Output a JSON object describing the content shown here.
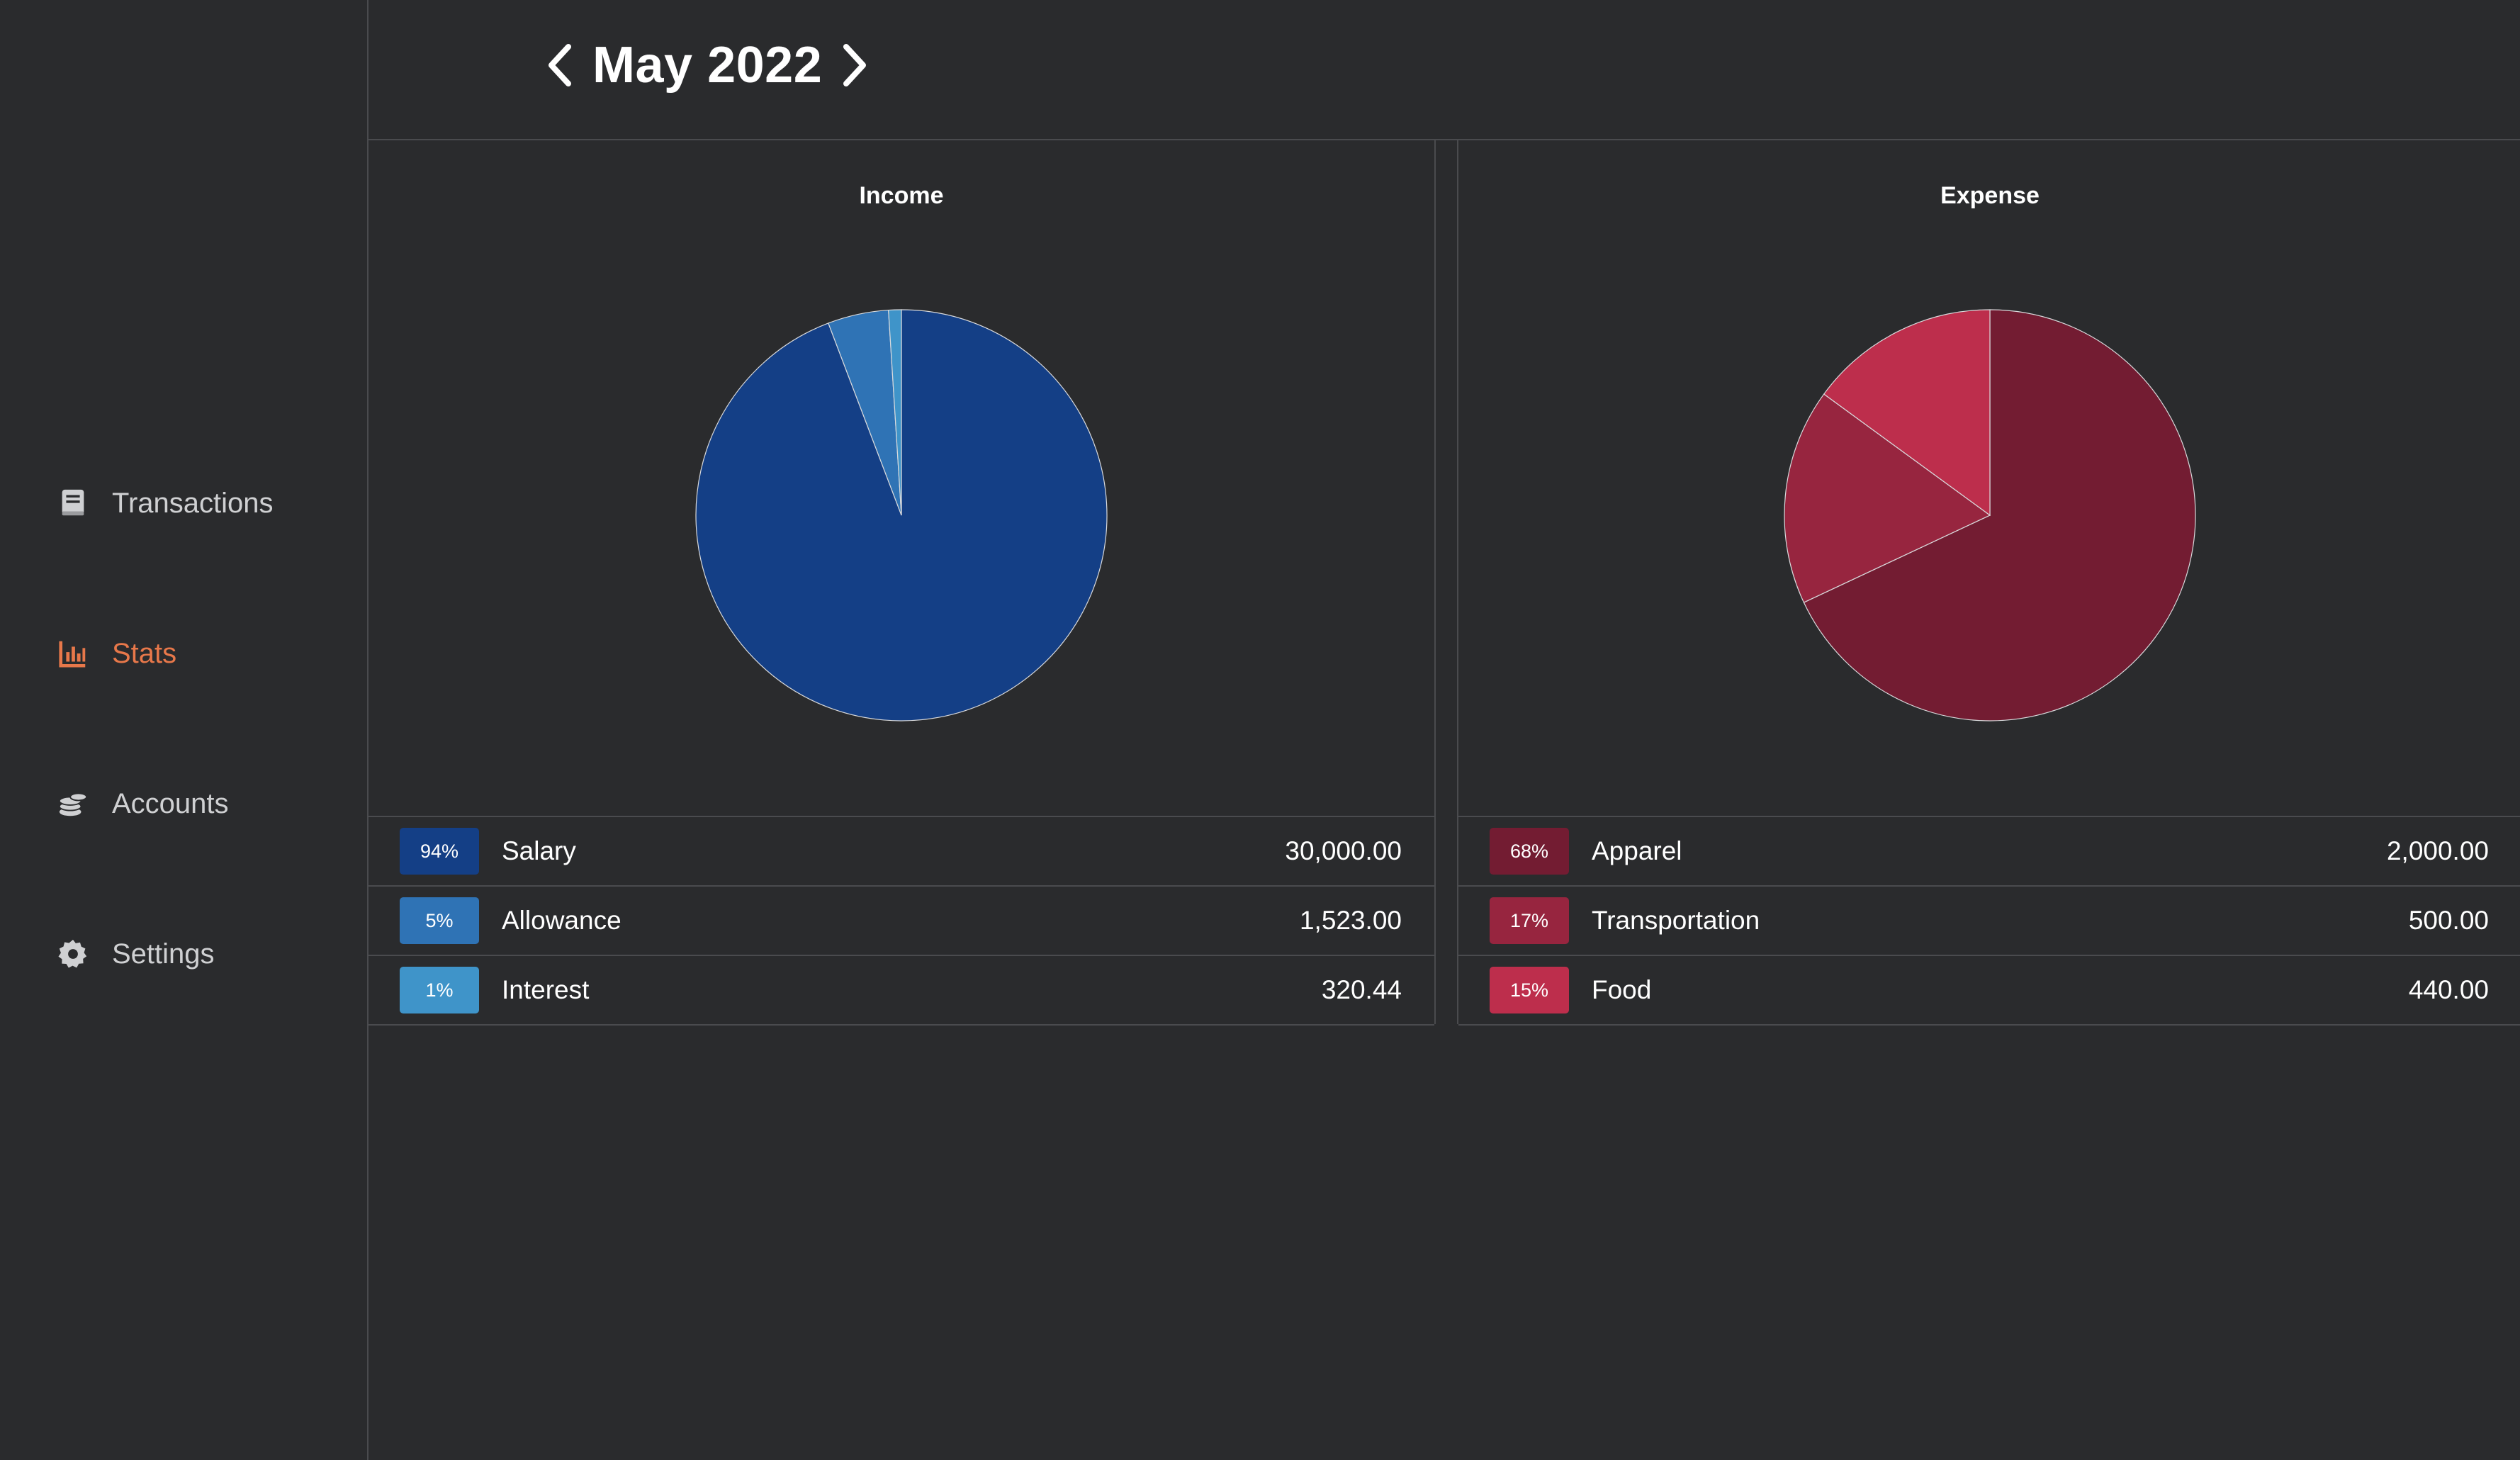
{
  "sidebar": {
    "items": [
      {
        "label": "Transactions",
        "icon": "receipt-icon",
        "active": false
      },
      {
        "label": "Stats",
        "icon": "bar-chart-icon",
        "active": true
      },
      {
        "label": "Accounts",
        "icon": "coins-icon",
        "active": false
      },
      {
        "label": "Settings",
        "icon": "gear-icon",
        "active": false
      }
    ]
  },
  "header": {
    "month": "May 2022",
    "prev_icon": "chevron-left-icon",
    "next_icon": "chevron-right-icon"
  },
  "colors": {
    "background": "#2a2b2d",
    "border": "#4a4b4e",
    "accent": "#e8784a",
    "text_muted": "#cfd0d2"
  },
  "chart_data": [
    {
      "type": "pie",
      "title": "Income",
      "categories": [
        "Salary",
        "Allowance",
        "Interest"
      ],
      "values": [
        30000.0,
        1523.0,
        320.44
      ],
      "percent_labels": [
        "94%",
        "5%",
        "1%"
      ],
      "amount_labels": [
        "30,000.00",
        "1,523.00",
        "320.44"
      ],
      "colors": [
        "#143f86",
        "#2f73b5",
        "#3f94c9"
      ]
    },
    {
      "type": "pie",
      "title": "Expense",
      "categories": [
        "Apparel",
        "Transportation",
        "Food"
      ],
      "values": [
        2000.0,
        500.0,
        440.0
      ],
      "percent_labels": [
        "68%",
        "17%",
        "15%"
      ],
      "amount_labels": [
        "2,000.00",
        "500.00",
        "440.00"
      ],
      "colors": [
        "#731c32",
        "#97253f",
        "#bd2e4c"
      ]
    }
  ]
}
